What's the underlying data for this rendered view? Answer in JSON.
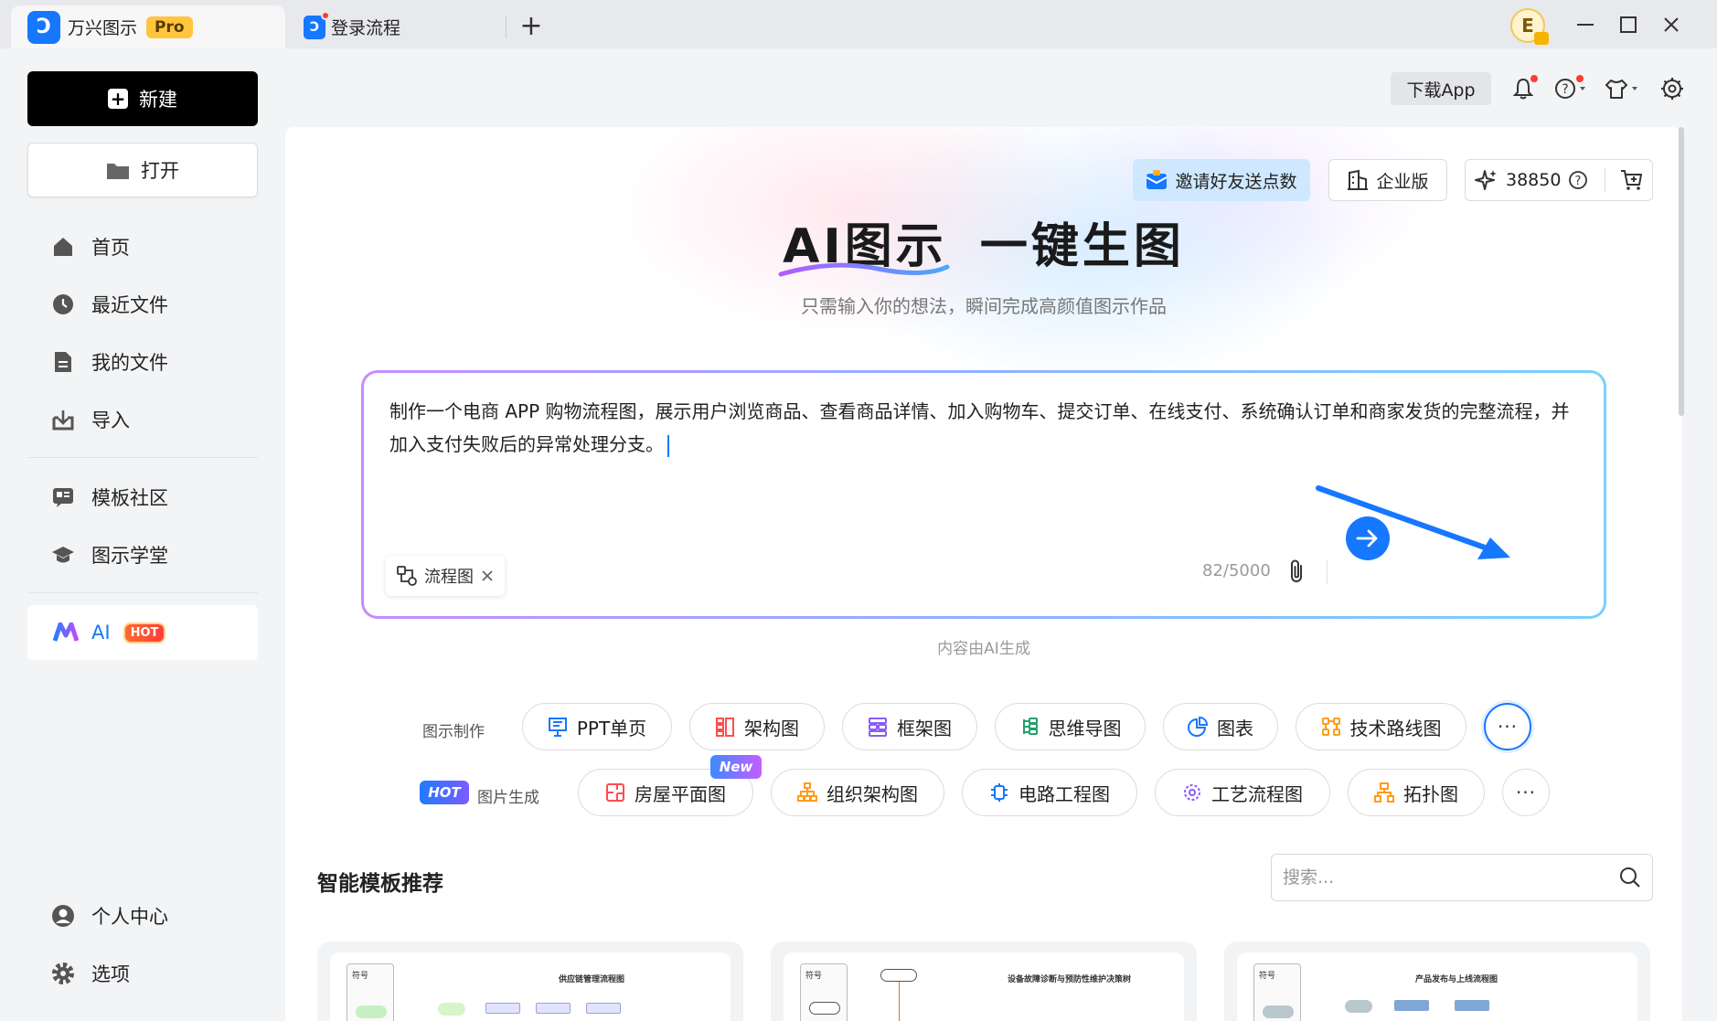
{
  "tabs": [
    {
      "label": "万兴图示",
      "badge": "Pro"
    },
    {
      "label": "登录流程"
    }
  ],
  "titlebar": {
    "avatar_letter": "E"
  },
  "sidebar": {
    "new_label": "新建",
    "open_label": "打开",
    "items": [
      {
        "label": "首页",
        "icon": "home-icon"
      },
      {
        "label": "最近文件",
        "icon": "clock-icon"
      },
      {
        "label": "我的文件",
        "icon": "file-icon"
      },
      {
        "label": "导入",
        "icon": "import-icon"
      },
      {
        "label": "模板社区",
        "icon": "template-icon"
      },
      {
        "label": "图示学堂",
        "icon": "graduation-cap-icon"
      }
    ],
    "ai": {
      "label": "AI",
      "badge": "HOT"
    },
    "bottom": [
      {
        "label": "个人中心",
        "icon": "user-icon"
      },
      {
        "label": "选项",
        "icon": "gear-icon"
      }
    ]
  },
  "header": {
    "download_label": "下载App"
  },
  "promo": {
    "invite_label": "邀请好友送点数",
    "enterprise_label": "企业版",
    "points": "38850"
  },
  "hero": {
    "title_a": "AI图示",
    "title_b": "一键生图",
    "subtitle": "只需输入你的想法，瞬间完成高颜值图示作品"
  },
  "prompt": {
    "text": "制作一个电商 APP 购物流程图，展示用户浏览商品、查看商品详情、加入购物车、提交订单、在线支付、系统确认订单和商家发货的完整流程，并加入支付失败后的异常处理分支。",
    "chip_label": "流程图",
    "counter": "82/5000"
  },
  "ai_note": "内容由AI生成",
  "row1": {
    "label": "图示制作",
    "chips": [
      "PPT单页",
      "架构图",
      "框架图",
      "思维导图",
      "图表",
      "技术路线图"
    ],
    "more": "···"
  },
  "row2": {
    "hot_badge": "HOT",
    "label": "图片生成",
    "new_badge": "New",
    "chips": [
      "房屋平面图",
      "组织架构图",
      "电路工程图",
      "工艺流程图",
      "拓扑图"
    ],
    "more": "···"
  },
  "templates": {
    "title": "智能模板推荐",
    "search_placeholder": "搜索...",
    "cards": [
      {
        "title": "供应链管理流程图",
        "side": "符号"
      },
      {
        "title": "设备故障诊断与预防性维护决策树",
        "side": "符号"
      },
      {
        "title": "产品发布与上线流程图",
        "side": "符号"
      }
    ]
  },
  "colors": {
    "accent": "#1677ff",
    "hot": "#ff4d2e",
    "pro": "#ffc53d"
  }
}
